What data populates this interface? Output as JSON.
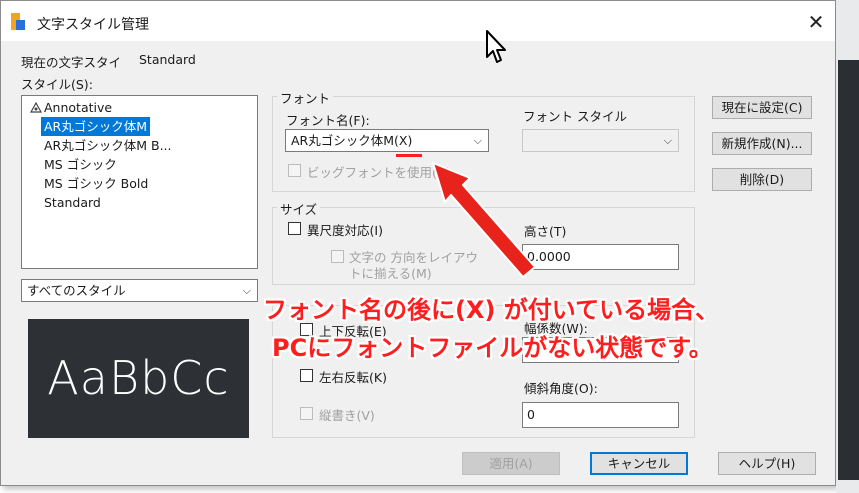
{
  "window": {
    "title": "文字スタイル管理",
    "close": "✕"
  },
  "current_style": {
    "label": "現在の文字スタイ",
    "value": "Standard"
  },
  "styles_label": "スタイル(S):",
  "style_list": [
    {
      "label": "Annotative",
      "icon": "annotative-icon",
      "selected": false
    },
    {
      "label": "AR丸ゴシック体M",
      "selected": true
    },
    {
      "label": "AR丸ゴシック体M B...",
      "selected": false
    },
    {
      "label": "MS ゴシック",
      "selected": false
    },
    {
      "label": "MS ゴシック Bold",
      "selected": false
    },
    {
      "label": "Standard",
      "selected": false
    }
  ],
  "style_filter": {
    "value": "すべてのスタイル"
  },
  "preview": {
    "text": "AaBbCc"
  },
  "font_group": {
    "title": "フォント",
    "font_name_label": "フォント名(F):",
    "font_name_value": "AR丸ゴシック体M(X)",
    "font_style_label": "フォント スタイル",
    "font_style_value": "",
    "bigfont_label": "ビッグフォントを使用(U)"
  },
  "size_group": {
    "title": "サイズ",
    "annotative_label": "異尺度対応(I)",
    "orientation_label_1": "文字の 方向をレイアウ",
    "orientation_label_2": "トに揃える(M)",
    "height_label": "高さ(T)",
    "height_value": "0.0000"
  },
  "effects_group": {
    "upside_down_label": "上下反転(E)",
    "width_factor_label": "幅係数(W):",
    "backwards_label": "左右反転(K)",
    "vertical_label": "縦書き(V)",
    "oblique_label": "傾斜角度(O):",
    "oblique_value": "0"
  },
  "side_buttons": {
    "set_current": "現在に設定(C)",
    "new": "新規作成(N)...",
    "delete": "削除(D)"
  },
  "bottom_buttons": {
    "apply": "適用(A)",
    "cancel": "キャンセル",
    "help": "ヘルプ(H)"
  },
  "annotation": {
    "line1": "フォント名の後に(X) が付いている場合、",
    "line2": "PCにフォントファイルがない状態です。",
    "color": "#ff1e1e"
  },
  "colors": {
    "selection": "#0078d7",
    "preview_bg": "#2d3136"
  }
}
